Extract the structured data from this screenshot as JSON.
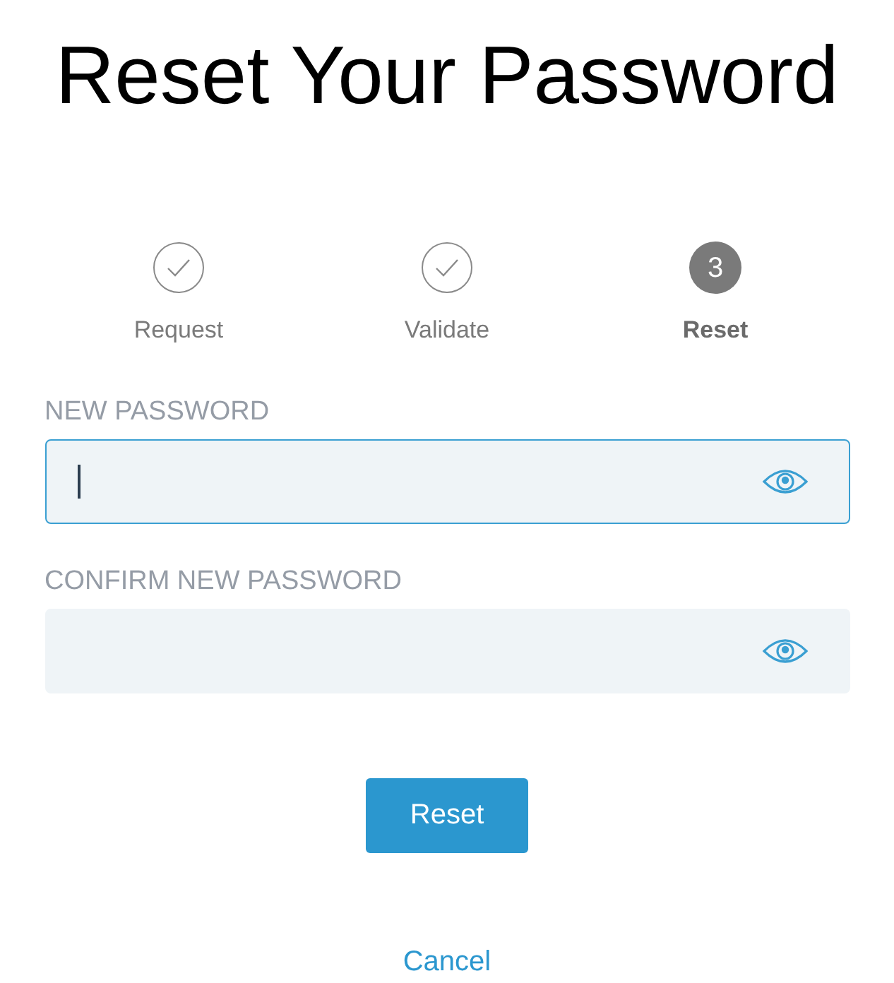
{
  "title": "Reset Your Password",
  "steps": [
    {
      "label": "Request",
      "kind": "done"
    },
    {
      "label": "Validate",
      "kind": "done"
    },
    {
      "label": "Reset",
      "kind": "current",
      "number": "3"
    }
  ],
  "fields": [
    {
      "label": "NEW PASSWORD",
      "focused": true
    },
    {
      "label": "CONFIRM NEW PASSWORD",
      "focused": false
    }
  ],
  "submit": "Reset",
  "cancel": "Cancel"
}
